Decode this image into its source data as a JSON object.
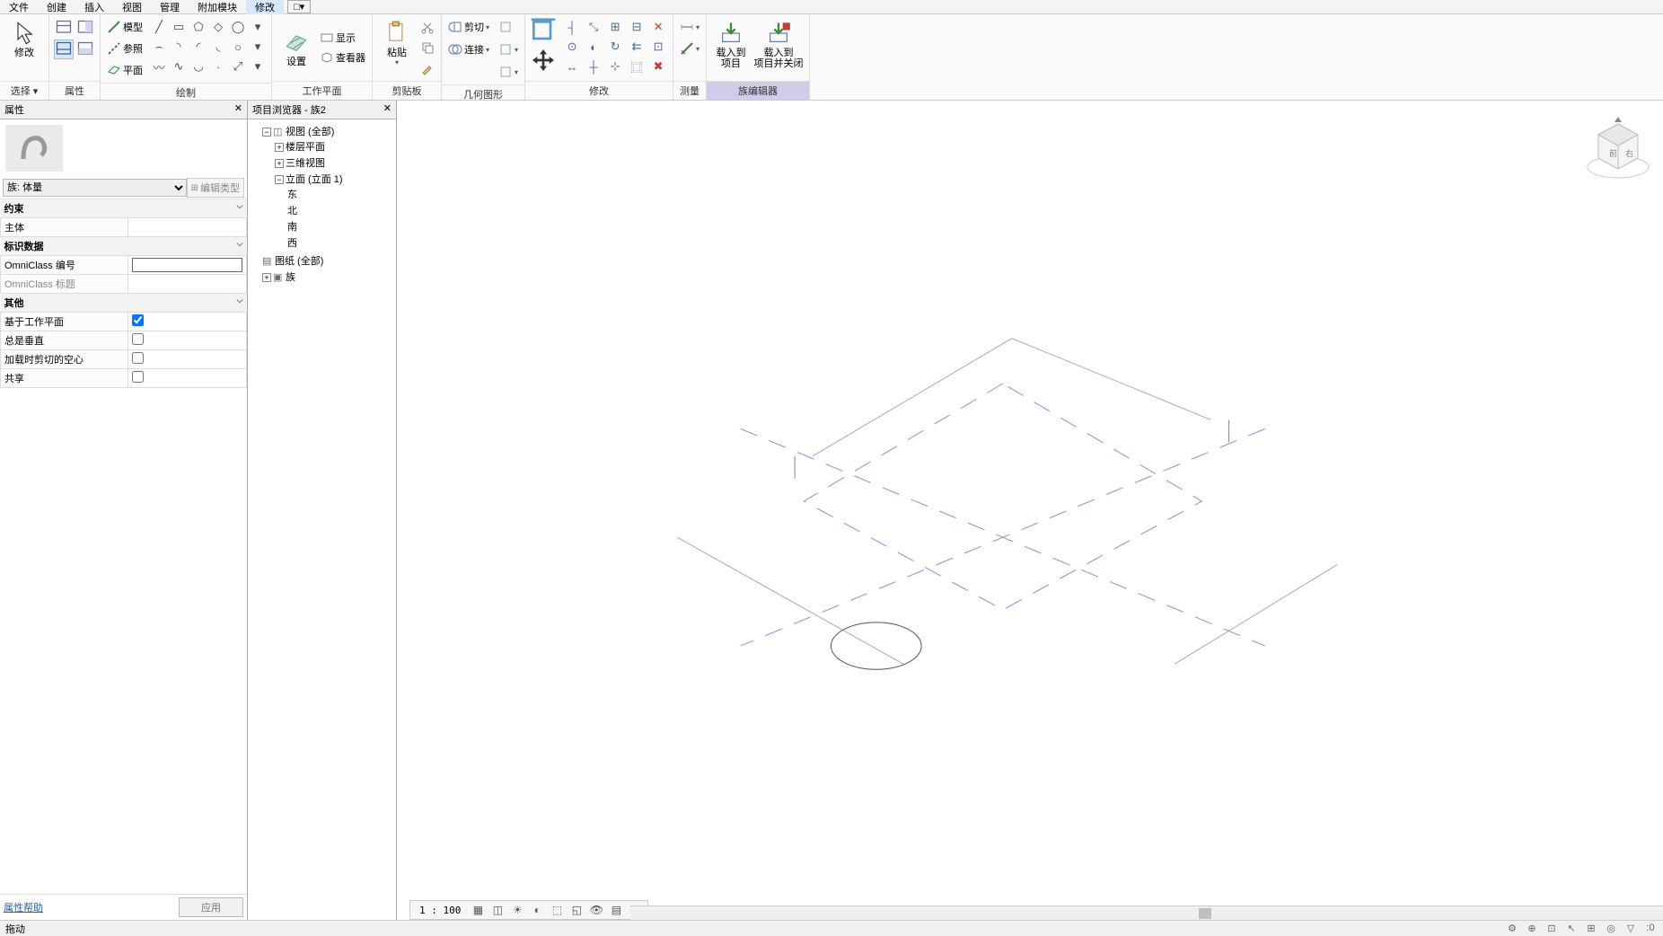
{
  "menu": {
    "items": [
      "文件",
      "创建",
      "插入",
      "视图",
      "管理",
      "附加模块",
      "修改"
    ],
    "active_index": 6,
    "overflow": "□▾"
  },
  "ribbon": {
    "panels": [
      {
        "title": "选择 ▾",
        "btns": [
          {
            "label": "修改"
          }
        ]
      },
      {
        "title": "属性",
        "btns": []
      },
      {
        "title": "绘制",
        "rows": [
          {
            "label": "模型"
          },
          {
            "label": "参照"
          },
          {
            "label": "平面"
          }
        ]
      },
      {
        "title": "工作平面",
        "btns": [
          {
            "label": "设置"
          },
          {
            "label": "显示"
          },
          {
            "label": "查看器"
          }
        ]
      },
      {
        "title": "剪贴板",
        "btns": [
          {
            "label": "粘贴"
          }
        ]
      },
      {
        "title": "几何图形",
        "rows": [
          {
            "label": "剪切"
          },
          {
            "label": "连接"
          }
        ]
      },
      {
        "title": "修改"
      },
      {
        "title": "测量"
      },
      {
        "title": "族编辑器",
        "active": true,
        "btns": [
          {
            "label1": "载入到",
            "label2": "项目"
          },
          {
            "label1": "载入到",
            "label2": "项目并关闭"
          }
        ]
      }
    ]
  },
  "props": {
    "header": "属性",
    "family_selector": "族: 体量",
    "edit_type": "编辑类型",
    "groups": [
      {
        "name": "约束",
        "rows": [
          {
            "k": "主体",
            "v": ""
          }
        ]
      },
      {
        "name": "标识数据",
        "rows": [
          {
            "k": "OmniClass 编号",
            "v": "",
            "input": true
          },
          {
            "k": "OmniClass 标题",
            "v": "",
            "disabled": true
          }
        ]
      },
      {
        "name": "其他",
        "rows": [
          {
            "k": "基于工作平面",
            "checkbox": true,
            "checked": true
          },
          {
            "k": "总是垂直",
            "checkbox": true,
            "checked": false
          },
          {
            "k": "加载时剪切的空心",
            "checkbox": true,
            "checked": false
          },
          {
            "k": "共享",
            "checkbox": true,
            "checked": false
          }
        ]
      }
    ],
    "help": "属性帮助",
    "apply": "应用"
  },
  "browser": {
    "header": "项目浏览器 - 族2",
    "tree": [
      {
        "expand": "−",
        "icon": "📋",
        "label": "视图 (全部)",
        "children": [
          {
            "expand": "+",
            "label": "楼层平面"
          },
          {
            "expand": "+",
            "label": "三维视图"
          },
          {
            "expand": "−",
            "label": "立面 (立面 1)",
            "children": [
              {
                "label": "东"
              },
              {
                "label": "北"
              },
              {
                "label": "南"
              },
              {
                "label": "西"
              }
            ]
          }
        ]
      },
      {
        "icon": "📄",
        "label": "图纸 (全部)"
      },
      {
        "expand": "+",
        "icon": "📁",
        "label": "族"
      }
    ]
  },
  "viewbar": {
    "scale": "1 : 100"
  },
  "status": {
    "left": "拖动",
    "right": ":0"
  }
}
